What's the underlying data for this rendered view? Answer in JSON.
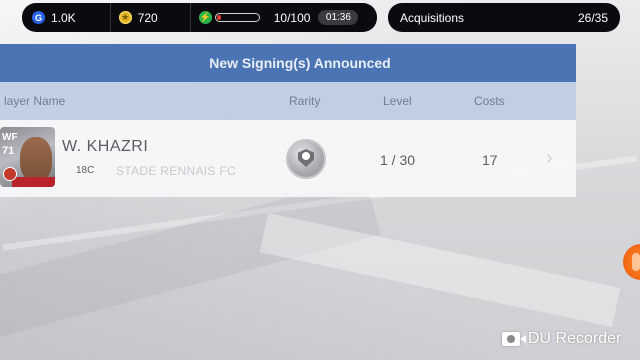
{
  "resources": {
    "gp": "1.0K",
    "coins": "720",
    "energy": "10/100",
    "energy_fill": 0.1,
    "timer": "01:36"
  },
  "acquisitions": {
    "label": "Acquisitions",
    "count": "26/35"
  },
  "panel": {
    "title": "New Signing(s) Announced",
    "columns": {
      "player_name": "layer Name",
      "rarity": "Rarity",
      "level": "Level",
      "costs": "Costs"
    },
    "rows": [
      {
        "card_position": "WF",
        "card_rating": "71",
        "name": "W. KHAZRI",
        "badge": "18C",
        "club": "STADE RENNAIS FC",
        "rarity": "silver-ball",
        "level": "1 / 30",
        "cost": "17"
      }
    ]
  },
  "watermark": {
    "text": "DU Recorder"
  },
  "icons": {
    "gp": "g-icon",
    "coins": "coin-icon",
    "energy": "lightning-icon",
    "rarity": "silver-ball-icon",
    "row_arrow": "chevron-right-icon",
    "watermark": "video-camera-icon"
  },
  "colors": {
    "header_blue": "#4a74b3",
    "column_bar": "#bccae0",
    "energy_red": "#e33a2f",
    "gp_blue": "#2a63e8",
    "coin_gold": "#e1b425",
    "energy_green": "#2bb34a"
  }
}
